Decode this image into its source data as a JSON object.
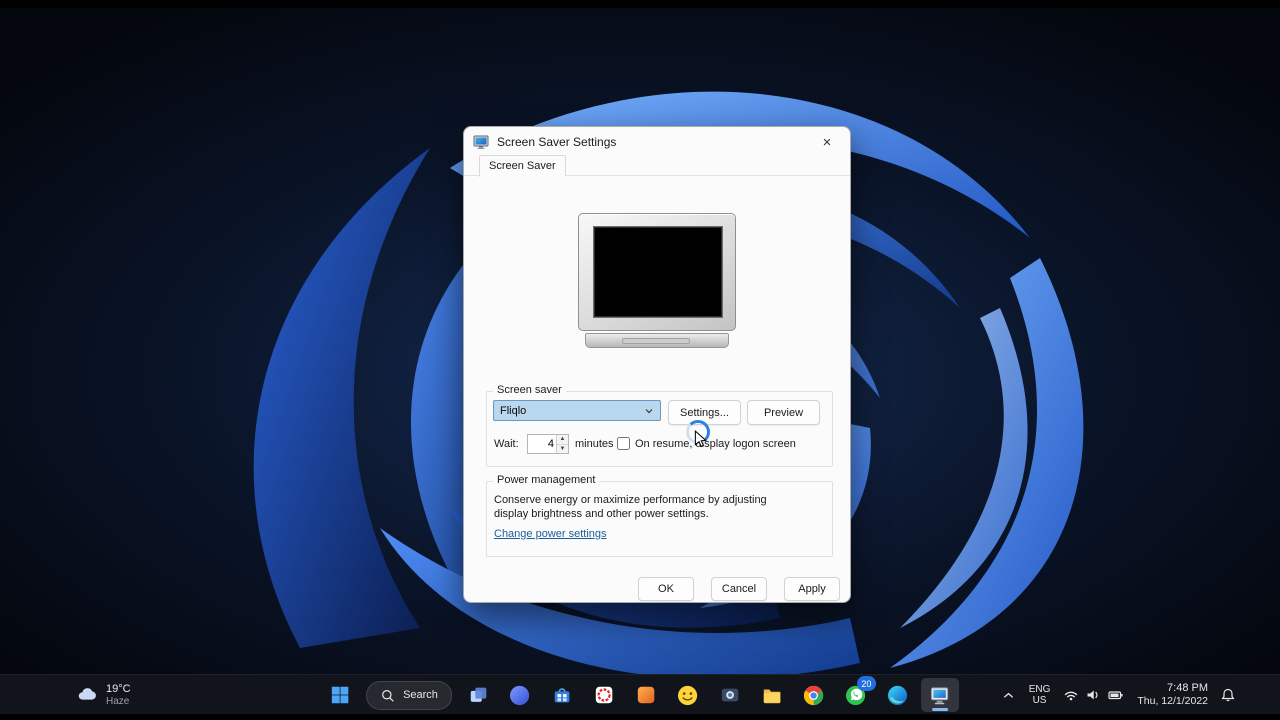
{
  "window": {
    "title": "Screen Saver Settings",
    "close": "×",
    "tab_label": "Screen Saver"
  },
  "screen_saver_section": {
    "group_label": "Screen saver",
    "selected_screensaver": "Fliqlo",
    "settings_button": "Settings...",
    "preview_button": "Preview",
    "wait_label": "Wait:",
    "wait_minutes": "4",
    "minutes_label": "minutes",
    "on_resume_label": "On resume, display logon screen"
  },
  "power_section": {
    "group_label": "Power management",
    "description_line1": "Conserve energy or maximize performance by adjusting",
    "description_line2": "display brightness and other power settings.",
    "change_power_link": "Change power settings"
  },
  "dialog_buttons": {
    "ok": "OK",
    "cancel": "Cancel",
    "apply": "Apply"
  },
  "taskbar": {
    "weather": {
      "temperature": "19°C",
      "condition": "Haze"
    },
    "search_label": "Search",
    "whatsapp_badge_count": "20",
    "app_icons": [
      "start",
      "search",
      "task-view",
      "blue-app",
      "microsoft-store",
      "red-app",
      "orange-app",
      "emoji-app",
      "camera-app",
      "file-explorer",
      "chrome",
      "whatsapp",
      "edge",
      "screen-saver-settings-active"
    ],
    "tray": {
      "language_top": "ENG",
      "language_bottom": "US",
      "time": "7:48 PM",
      "date": "Thu, 12/1/2022"
    }
  },
  "icons": {
    "spin_up": "▲",
    "spin_down": "▼"
  },
  "colors": {
    "taskbar_bg": "#12141c",
    "accent_blue": "#0078d4",
    "combo_bg": "#b9d7ef",
    "link_color": "#1b5e9e",
    "badge_blue": "#1f6fe0"
  }
}
